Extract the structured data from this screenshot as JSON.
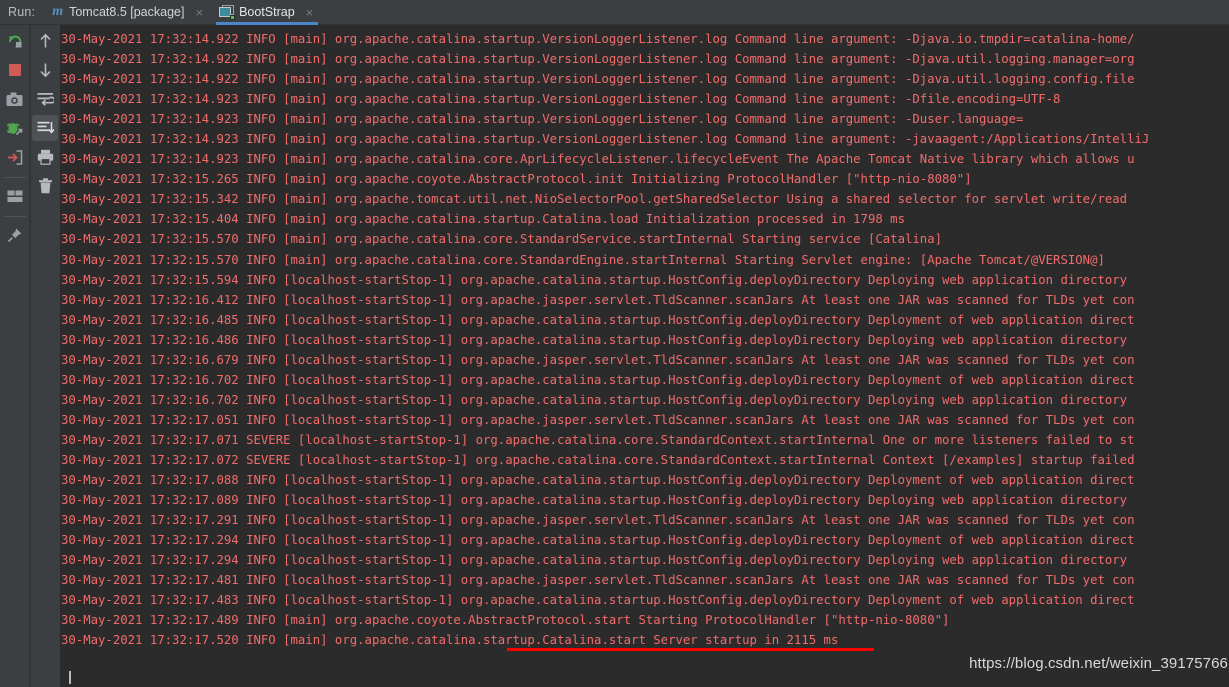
{
  "window": {
    "run_label": "Run:",
    "background": "#2b2b2b",
    "toolbar_background": "#3c3f41",
    "log_color": "#f26b6b",
    "accent_color": "#4b86c9"
  },
  "tabs": [
    {
      "label": "Tomcat8.5 [package]",
      "icon": "maven-icon",
      "close": "×",
      "active": false
    },
    {
      "label": "BootStrap",
      "icon": "run-config-icon",
      "close": "×",
      "active": true
    }
  ],
  "toolbar_left": [
    {
      "name": "rerun-icon",
      "title": "Rerun"
    },
    {
      "name": "stop-icon",
      "title": "Stop"
    },
    {
      "name": "camera-icon",
      "title": "Screenshot"
    },
    {
      "name": "debug-icon",
      "title": "Debug"
    },
    {
      "name": "exit-icon",
      "title": "Exit"
    },
    {
      "name": "layout-icon",
      "title": "Layout"
    },
    {
      "name": "pin-icon",
      "title": "Pin Tab"
    }
  ],
  "toolbar_right": [
    {
      "name": "arrow-up-icon",
      "title": "Up the Stack Trace"
    },
    {
      "name": "arrow-down-icon",
      "title": "Down the Stack Trace"
    },
    {
      "name": "soft-wrap-icon",
      "title": "Use Soft Wraps"
    },
    {
      "name": "scroll-to-end-icon",
      "title": "Scroll to the End",
      "selected": true
    },
    {
      "name": "print-icon",
      "title": "Print"
    },
    {
      "name": "trash-icon",
      "title": "Clear All"
    }
  ],
  "console": {
    "caret": true,
    "lines": [
      "30-May-2021 17:32:14.922 INFO [main] org.apache.catalina.startup.VersionLoggerListener.log Command line argument: -Djava.io.tmpdir=catalina-home/",
      "30-May-2021 17:32:14.922 INFO [main] org.apache.catalina.startup.VersionLoggerListener.log Command line argument: -Djava.util.logging.manager=org",
      "30-May-2021 17:32:14.922 INFO [main] org.apache.catalina.startup.VersionLoggerListener.log Command line argument: -Djava.util.logging.config.file",
      "30-May-2021 17:32:14.923 INFO [main] org.apache.catalina.startup.VersionLoggerListener.log Command line argument: -Dfile.encoding=UTF-8",
      "30-May-2021 17:32:14.923 INFO [main] org.apache.catalina.startup.VersionLoggerListener.log Command line argument: -Duser.language=",
      "30-May-2021 17:32:14.923 INFO [main] org.apache.catalina.startup.VersionLoggerListener.log Command line argument: -javaagent:/Applications/IntelliJ",
      "30-May-2021 17:32:14.923 INFO [main] org.apache.catalina.core.AprLifecycleListener.lifecycleEvent The Apache Tomcat Native library which allows u",
      "30-May-2021 17:32:15.265 INFO [main] org.apache.coyote.AbstractProtocol.init Initializing ProtocolHandler [\"http-nio-8080\"]",
      "30-May-2021 17:32:15.342 INFO [main] org.apache.tomcat.util.net.NioSelectorPool.getSharedSelector Using a shared selector for servlet write/read",
      "30-May-2021 17:32:15.404 INFO [main] org.apache.catalina.startup.Catalina.load Initialization processed in 1798 ms",
      "30-May-2021 17:32:15.570 INFO [main] org.apache.catalina.core.StandardService.startInternal Starting service [Catalina]",
      "30-May-2021 17:32:15.570 INFO [main] org.apache.catalina.core.StandardEngine.startInternal Starting Servlet engine: [Apache Tomcat/@VERSION@]",
      "30-May-2021 17:32:15.594 INFO [localhost-startStop-1] org.apache.catalina.startup.HostConfig.deployDirectory Deploying web application directory",
      "30-May-2021 17:32:16.412 INFO [localhost-startStop-1] org.apache.jasper.servlet.TldScanner.scanJars At least one JAR was scanned for TLDs yet con",
      "30-May-2021 17:32:16.485 INFO [localhost-startStop-1] org.apache.catalina.startup.HostConfig.deployDirectory Deployment of web application direct",
      "30-May-2021 17:32:16.486 INFO [localhost-startStop-1] org.apache.catalina.startup.HostConfig.deployDirectory Deploying web application directory",
      "30-May-2021 17:32:16.679 INFO [localhost-startStop-1] org.apache.jasper.servlet.TldScanner.scanJars At least one JAR was scanned for TLDs yet con",
      "30-May-2021 17:32:16.702 INFO [localhost-startStop-1] org.apache.catalina.startup.HostConfig.deployDirectory Deployment of web application direct",
      "30-May-2021 17:32:16.702 INFO [localhost-startStop-1] org.apache.catalina.startup.HostConfig.deployDirectory Deploying web application directory",
      "30-May-2021 17:32:17.051 INFO [localhost-startStop-1] org.apache.jasper.servlet.TldScanner.scanJars At least one JAR was scanned for TLDs yet con",
      "30-May-2021 17:32:17.071 SEVERE [localhost-startStop-1] org.apache.catalina.core.StandardContext.startInternal One or more listeners failed to st",
      "30-May-2021 17:32:17.072 SEVERE [localhost-startStop-1] org.apache.catalina.core.StandardContext.startInternal Context [/examples] startup failed",
      "30-May-2021 17:32:17.088 INFO [localhost-startStop-1] org.apache.catalina.startup.HostConfig.deployDirectory Deployment of web application direct",
      "30-May-2021 17:32:17.089 INFO [localhost-startStop-1] org.apache.catalina.startup.HostConfig.deployDirectory Deploying web application directory",
      "30-May-2021 17:32:17.291 INFO [localhost-startStop-1] org.apache.jasper.servlet.TldScanner.scanJars At least one JAR was scanned for TLDs yet con",
      "30-May-2021 17:32:17.294 INFO [localhost-startStop-1] org.apache.catalina.startup.HostConfig.deployDirectory Deployment of web application direct",
      "30-May-2021 17:32:17.294 INFO [localhost-startStop-1] org.apache.catalina.startup.HostConfig.deployDirectory Deploying web application directory",
      "30-May-2021 17:32:17.481 INFO [localhost-startStop-1] org.apache.jasper.servlet.TldScanner.scanJars At least one JAR was scanned for TLDs yet con",
      "30-May-2021 17:32:17.483 INFO [localhost-startStop-1] org.apache.catalina.startup.HostConfig.deployDirectory Deployment of web application direct",
      "30-May-2021 17:32:17.489 INFO [main] org.apache.coyote.AbstractProtocol.start Starting ProtocolHandler [\"http-nio-8080\"]",
      "30-May-2021 17:32:17.520 INFO [main] org.apache.catalina.startup.Catalina.start Server startup in 2115 ms"
    ]
  },
  "annotation": {
    "underline_color": "#ff0000",
    "underline_target": "Server startup in 2115 ms"
  },
  "watermark": {
    "text": "https://blog.csdn.net/weixin_39175766"
  }
}
